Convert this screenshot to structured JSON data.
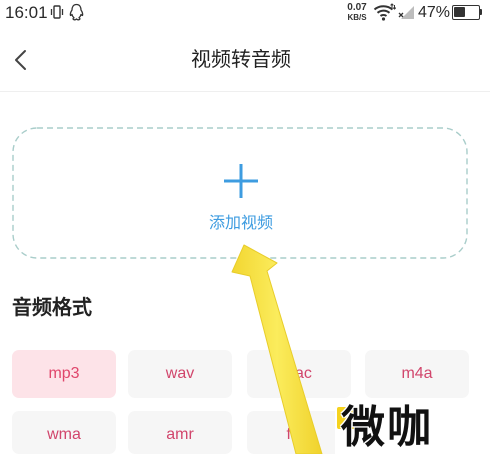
{
  "status_bar": {
    "time": "16:01",
    "net_speed_value": "0.07",
    "net_speed_unit": "KB/S",
    "battery_text": "47%",
    "battery_level": 0.47,
    "icons": [
      "vibrate-icon",
      "qq-icon",
      "wifi-icon",
      "signal-no-sim-icon",
      "battery-icon"
    ]
  },
  "header": {
    "title": "视频转音频",
    "back_icon": "chevron-left-icon"
  },
  "add_video": {
    "label": "添加视频",
    "icon": "plus-icon"
  },
  "formats": {
    "section_title": "音频格式",
    "selected": "mp3",
    "items": [
      {
        "label": "mp3"
      },
      {
        "label": "wav"
      },
      {
        "label": "aac"
      },
      {
        "label": "m4a"
      },
      {
        "label": "wma"
      },
      {
        "label": "amr"
      },
      {
        "label": "flac"
      }
    ]
  },
  "watermark": {
    "text": "微咖"
  },
  "colors": {
    "accent": "#3e9ce0",
    "format_text": "#d1466c",
    "cell_bg": "#f6f6f6",
    "selected_bg": "#fde3e8",
    "dashed_border": "#a9cdca",
    "annotation_arrow": "#f9e547"
  }
}
